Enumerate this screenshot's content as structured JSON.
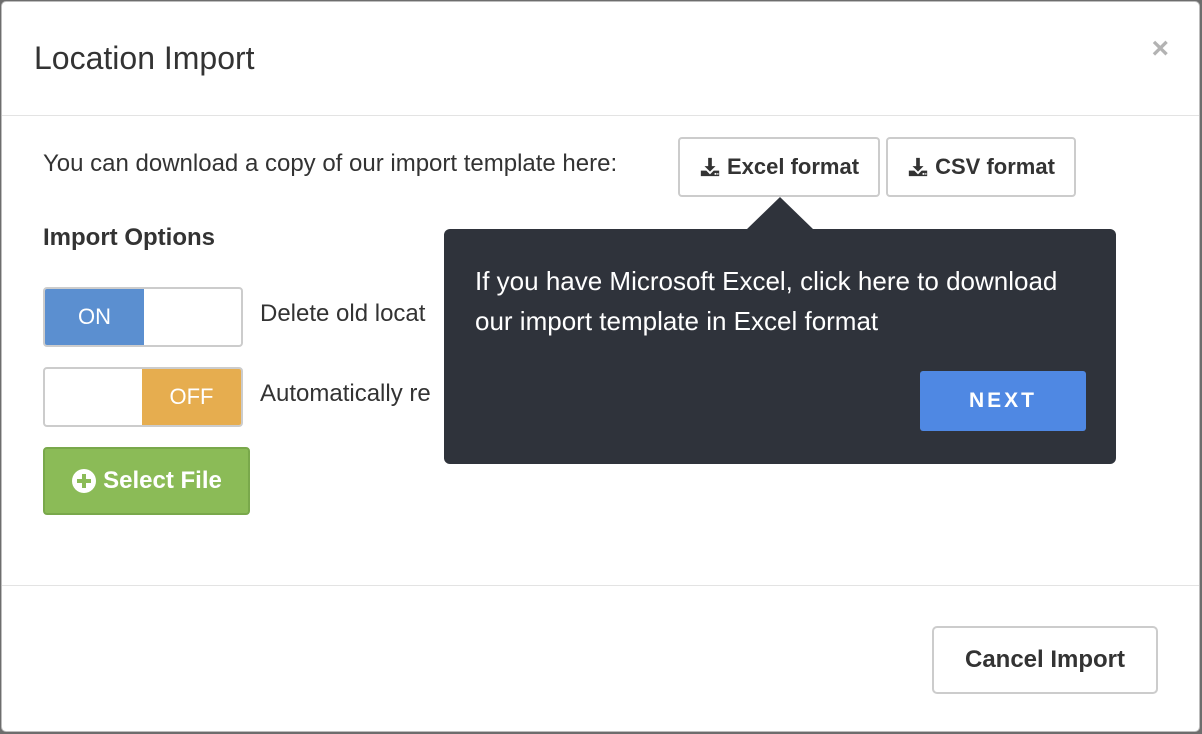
{
  "dialog": {
    "title": "Location Import",
    "close_label": "×"
  },
  "download": {
    "text": "You can download a copy of our import template here:",
    "excel_label": "Excel format",
    "csv_label": "CSV format"
  },
  "options": {
    "title": "Import Options",
    "items": [
      {
        "state_label": "ON",
        "label": "Delete old locat"
      },
      {
        "state_label": "OFF",
        "label": "Automatically re"
      }
    ]
  },
  "select_file": {
    "label": "Select File"
  },
  "footer": {
    "cancel_label": "Cancel Import"
  },
  "tooltip": {
    "text": "If you have Microsoft Excel, click here to download our import template in Excel format",
    "next_label": "NEXT"
  },
  "colors": {
    "toggle_on": "#5b8fd0",
    "toggle_off": "#e6ad4f",
    "select_file": "#8bbb57",
    "tooltip_bg": "#2f333b",
    "next_button": "#4f88e3"
  }
}
